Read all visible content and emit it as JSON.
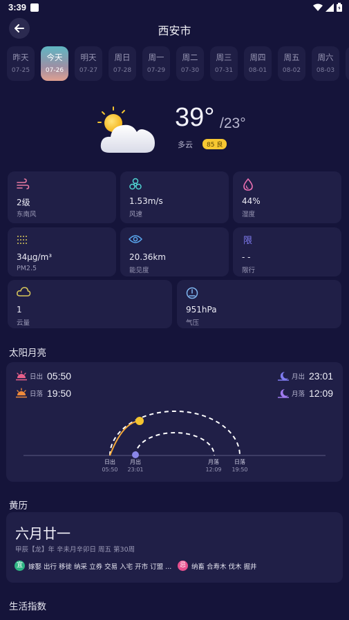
{
  "status": {
    "time": "3:39"
  },
  "header": {
    "city": "西安市"
  },
  "dates": [
    {
      "day": "昨天",
      "date": "07-25",
      "active": false
    },
    {
      "day": "今天",
      "date": "07-26",
      "active": true
    },
    {
      "day": "明天",
      "date": "07-27",
      "active": false
    },
    {
      "day": "周日",
      "date": "07-28",
      "active": false
    },
    {
      "day": "周一",
      "date": "07-29",
      "active": false
    },
    {
      "day": "周二",
      "date": "07-30",
      "active": false
    },
    {
      "day": "周三",
      "date": "07-31",
      "active": false
    },
    {
      "day": "周四",
      "date": "08-01",
      "active": false
    },
    {
      "day": "周五",
      "date": "08-02",
      "active": false
    },
    {
      "day": "周六",
      "date": "08-03",
      "active": false
    },
    {
      "day": "",
      "date": "",
      "active": false
    }
  ],
  "weather": {
    "icon": "partly-cloudy-icon",
    "temp_high": "39°",
    "temp_low": "/23°",
    "condition": "多云",
    "aqi": "85 良",
    "aqi_color": "#f7c832"
  },
  "cards": {
    "wind_level": {
      "value": "2级",
      "label": "东南风",
      "icon": "wind-icon",
      "color": "#e77aa2"
    },
    "wind_speed": {
      "value": "1.53m/s",
      "label": "风速",
      "icon": "fan-icon",
      "color": "#4fd3d1"
    },
    "humidity": {
      "value": "44%",
      "label": "湿度",
      "icon": "droplet-icon",
      "color": "#e96fb0"
    },
    "pm25": {
      "value": "34μg/m³",
      "label": "PM2.5",
      "icon": "dust-icon",
      "color": "#d9c85a"
    },
    "visibility": {
      "value": "20.36km",
      "label": "能见度",
      "icon": "eye-icon",
      "color": "#5aa8f0"
    },
    "restriction": {
      "value": "- -",
      "label": "限行",
      "icon_text": "限",
      "color": "#7f7bf0"
    },
    "cloud": {
      "value": "1",
      "label": "云量",
      "icon": "cloud-icon",
      "color": "#d9c85a"
    },
    "pressure": {
      "value": "951hPa",
      "label": "气压",
      "icon": "gauge-icon",
      "color": "#7fb6f0"
    }
  },
  "sun_moon": {
    "title": "太阳月亮",
    "sunrise_label": "日出",
    "sunrise": "05:50",
    "sunset_label": "日落",
    "sunset": "19:50",
    "moonrise_label": "月出",
    "moonrise": "23:01",
    "moonset_label": "月落",
    "moonset": "12:09",
    "axis": {
      "sunrise_label": "日出",
      "sunrise": "05:50",
      "moonrise_label": "月出",
      "moonrise": "23:01",
      "moonset_label": "月落",
      "moonset": "12:09",
      "sunset_label": "日落",
      "sunset": "19:50"
    }
  },
  "huangli": {
    "title": "黄历",
    "lunar_date": "六月廿一",
    "ganzhi": "甲辰【龙】年 辛未月辛卯日 周五 第30周",
    "yi_badge": "宜",
    "yi": "嫁娶 出行 移徙 纳采 立券 交易 入宅 开市 订盟 ...",
    "ji_badge": "忌",
    "ji": "纳畜 合寿木 伐木 掘井"
  },
  "life": {
    "title": "生活指数"
  }
}
